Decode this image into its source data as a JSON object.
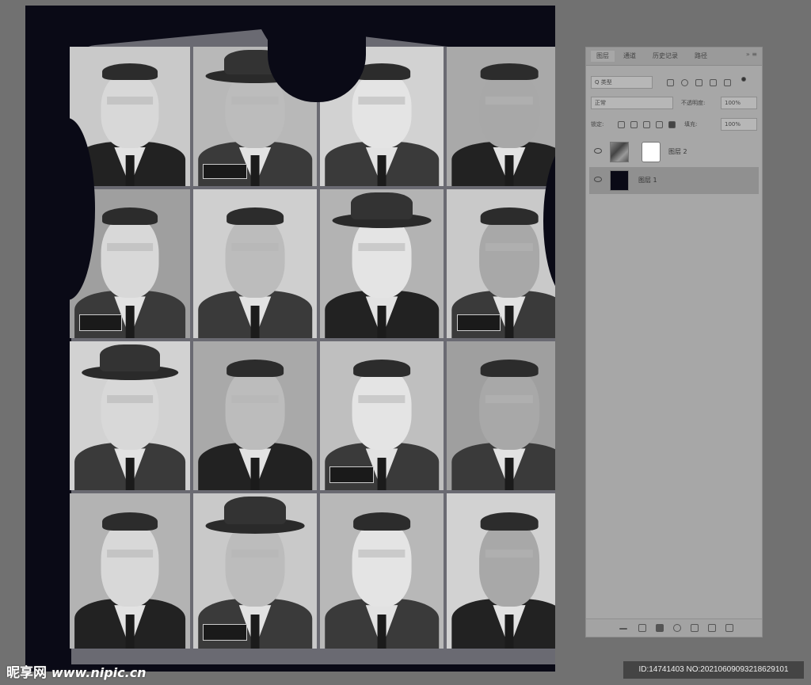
{
  "layers_panel": {
    "tabs": [
      "图层",
      "通道",
      "历史记录",
      "路径"
    ],
    "filter_kind": "Q 类型",
    "blend_mode": "正常",
    "opacity_label": "不透明度:",
    "opacity_value": "100%",
    "lock_label": "锁定:",
    "fill_label": "填充:",
    "fill_value": "100%",
    "layers": [
      {
        "name": "图层 2",
        "visible": true,
        "selected": false
      },
      {
        "name": "图层 1",
        "visible": true,
        "selected": true
      }
    ]
  },
  "watermark": {
    "brand": "昵享网",
    "url": "www.nipic.cn",
    "id_text": "ID:14741403 NO:20210609093218629101"
  },
  "colors": {
    "canvas_bg": "#0a0a16",
    "workspace": "#717171",
    "panel": "#a7a7a7"
  }
}
